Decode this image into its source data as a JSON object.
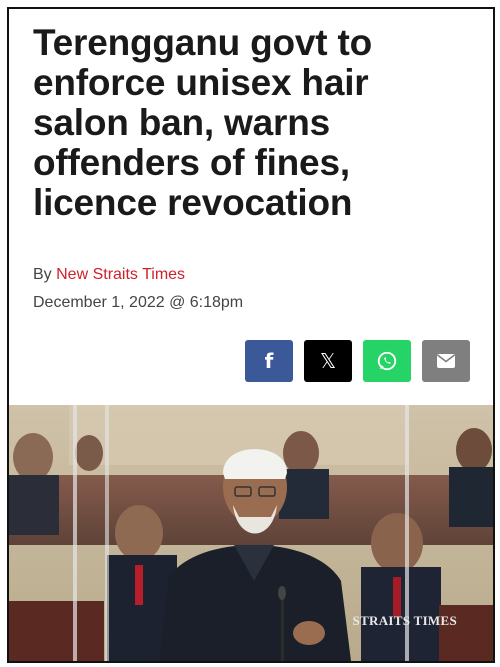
{
  "article": {
    "headline": "Terengganu govt to enforce unisex hair salon ban, warns offenders of fines, licence revocation",
    "byline_prefix": "By",
    "author": "New Straits Times",
    "date": "December 1, 2022 @ 6:18pm"
  },
  "share": {
    "facebook_glyph": "f",
    "x_glyph": "𝕏",
    "icons": [
      "facebook-icon",
      "x-icon",
      "whatsapp-icon",
      "email-icon"
    ],
    "colors": {
      "facebook": "#3b5998",
      "x": "#000000",
      "whatsapp": "#25d366",
      "email": "#7f7f7f"
    }
  },
  "photo": {
    "watermark": "STRAITS TIMES"
  },
  "colors": {
    "author": "#d0202a",
    "headline": "#1a1a1a"
  }
}
